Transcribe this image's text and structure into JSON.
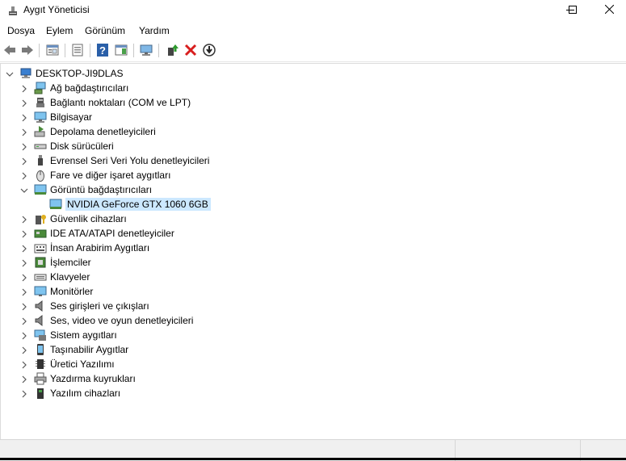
{
  "window": {
    "title": "Aygıt Yöneticisi",
    "controls": [
      "minimize-icon",
      "maximize-icon",
      "close-icon"
    ]
  },
  "menu": [
    "Dosya",
    "Eylem",
    "Görünüm",
    "Yardım"
  ],
  "toolbar": {
    "buttons": [
      "back-arrow-icon",
      "forward-arrow-icon",
      "show-hide-tree-icon",
      "properties-icon",
      "help-icon",
      "action-pane-icon",
      "scan-hardware-icon",
      "update-driver-icon",
      "uninstall-icon",
      "disable-device-icon"
    ],
    "colors": {
      "uninstall": "#d81e1e",
      "help": "#2a5fa8"
    }
  },
  "tree": {
    "root": "DESKTOP-JI9DLAS",
    "categories": [
      {
        "label": "Ağ bağdaştırıcıları",
        "icon": "network-adapter-icon",
        "expanded": false
      },
      {
        "label": "Bağlantı noktaları (COM ve LPT)",
        "icon": "port-icon",
        "expanded": false
      },
      {
        "label": "Bilgisayar",
        "icon": "computer-icon",
        "expanded": false
      },
      {
        "label": "Depolama denetleyicileri",
        "icon": "storage-controller-icon",
        "expanded": false
      },
      {
        "label": "Disk sürücüleri",
        "icon": "disk-drive-icon",
        "expanded": false
      },
      {
        "label": "Evrensel Seri Veri Yolu denetleyicileri",
        "icon": "usb-icon",
        "expanded": false
      },
      {
        "label": "Fare ve diğer işaret aygıtları",
        "icon": "mouse-icon",
        "expanded": false
      },
      {
        "label": "Görüntü bağdaştırıcıları",
        "icon": "display-adapter-icon",
        "expanded": true,
        "children": [
          {
            "label": "NVIDIA GeForce GTX 1060 6GB",
            "icon": "display-adapter-icon",
            "selected": true
          }
        ]
      },
      {
        "label": "Güvenlik cihazları",
        "icon": "security-device-icon",
        "expanded": false
      },
      {
        "label": "IDE ATA/ATAPI denetleyiciler",
        "icon": "ide-controller-icon",
        "expanded": false
      },
      {
        "label": "İnsan Arabirim Aygıtları",
        "icon": "hid-icon",
        "expanded": false
      },
      {
        "label": "İşlemciler",
        "icon": "processor-icon",
        "expanded": false
      },
      {
        "label": "Klavyeler",
        "icon": "keyboard-icon",
        "expanded": false
      },
      {
        "label": "Monitörler",
        "icon": "monitor-icon",
        "expanded": false
      },
      {
        "label": "Ses girişleri ve çıkışları",
        "icon": "speaker-icon",
        "expanded": false
      },
      {
        "label": "Ses, video ve oyun denetleyicileri",
        "icon": "speaker-icon",
        "expanded": false
      },
      {
        "label": "Sistem aygıtları",
        "icon": "system-device-icon",
        "expanded": false
      },
      {
        "label": "Taşınabilir Aygıtlar",
        "icon": "portable-device-icon",
        "expanded": false
      },
      {
        "label": "Üretici Yazılımı",
        "icon": "firmware-icon",
        "expanded": false
      },
      {
        "label": "Yazdırma kuyrukları",
        "icon": "printer-icon",
        "expanded": false
      },
      {
        "label": "Yazılım cihazları",
        "icon": "software-device-icon",
        "expanded": false
      }
    ],
    "selection_color": "#cce8ff"
  }
}
